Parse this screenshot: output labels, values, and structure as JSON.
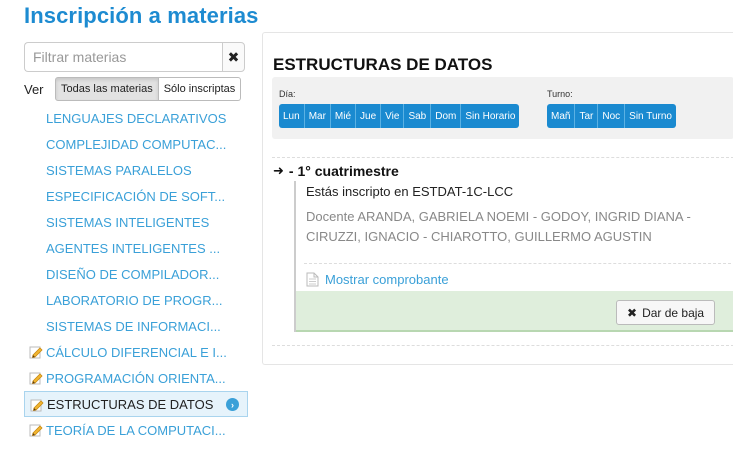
{
  "page": {
    "title": "Inscripción a materias"
  },
  "filter": {
    "placeholder": "Filtrar materias",
    "clear_icon": "✖"
  },
  "view": {
    "label": "Ver",
    "options": [
      "Todas las materias",
      "Sólo inscriptas"
    ],
    "selected": "Todas las materias"
  },
  "subjects": [
    {
      "label": "LENGUAJES DECLARATIVOS",
      "icon": "",
      "selected": false
    },
    {
      "label": "COMPLEJIDAD COMPUTAC...",
      "icon": "",
      "selected": false
    },
    {
      "label": "SISTEMAS PARALELOS",
      "icon": "",
      "selected": false
    },
    {
      "label": "ESPECIFICACIÓN DE SOFT...",
      "icon": "",
      "selected": false
    },
    {
      "label": "SISTEMAS INTELIGENTES",
      "icon": "",
      "selected": false
    },
    {
      "label": "AGENTES INTELIGENTES ...",
      "icon": "",
      "selected": false
    },
    {
      "label": "DISEÑO DE COMPILADOR...",
      "icon": "",
      "selected": false
    },
    {
      "label": "LABORATORIO DE PROGR...",
      "icon": "",
      "selected": false
    },
    {
      "label": "SISTEMAS DE INFORMACI...",
      "icon": "",
      "selected": false
    },
    {
      "label": "CÁLCULO DIFERENCIAL E I...",
      "icon": "pencil-icon",
      "selected": false
    },
    {
      "label": "PROGRAMACIÓN ORIENTA...",
      "icon": "pencil-icon",
      "selected": false
    },
    {
      "label": "ESTRUCTURAS DE DATOS",
      "icon": "pencil-icon",
      "selected": true
    },
    {
      "label": "TEORÍA DE LA COMPUTACI...",
      "icon": "pencil-icon",
      "selected": false
    }
  ],
  "course": {
    "title": "ESTRUCTURAS DE DATOS",
    "day_label": "Día:",
    "days": [
      "Lun",
      "Mar",
      "Mié",
      "Jue",
      "Vie",
      "Sab",
      "Dom",
      "Sin Horario"
    ],
    "shift_label": "Turno:",
    "shifts": [
      "Mañ",
      "Tar",
      "Noc",
      "Sin Turno"
    ],
    "period": "- 1° cuatrimestre",
    "enrollment": {
      "status": "Estás inscripto en ESTDAT-1C-LCC",
      "teachers": "Docente ARANDA, GABRIELA NOEMI - GODOY, INGRID DIANA - CIRUZZI, IGNACIO - CHIAROTTO, GUILLERMO AGUSTIN",
      "receipt_link": "Mostrar comprobante",
      "unenroll_button": "Dar de baja"
    }
  },
  "colors": {
    "brand": "#1d8bd1",
    "link": "#3aa0d8",
    "button_blue": "#1a8ad0",
    "enrolled_bg": "#dfeedc"
  }
}
